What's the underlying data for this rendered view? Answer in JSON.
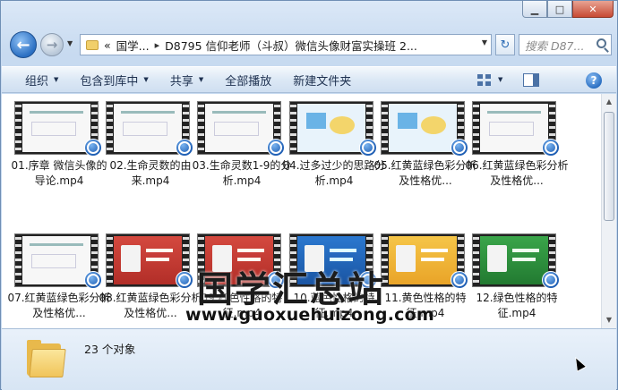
{
  "window": {
    "controls": {
      "minimize": "▁",
      "maximize": "□",
      "close": "✕"
    }
  },
  "nav": {
    "back_glyph": "←",
    "forward_glyph": "→"
  },
  "address": {
    "crumb_prefix": "«",
    "crumbs": [
      "国学...",
      "D8795 信仰老师（斗叔）微信头像财富实操班 2..."
    ],
    "separator": "▸"
  },
  "search": {
    "placeholder": "搜索 D87..."
  },
  "commands": [
    {
      "label": "组织",
      "has_dropdown": true
    },
    {
      "label": "包含到库中",
      "has_dropdown": true
    },
    {
      "label": "共享",
      "has_dropdown": true
    },
    {
      "label": "全部播放",
      "has_dropdown": false
    },
    {
      "label": "新建文件夹",
      "has_dropdown": false
    }
  ],
  "help_glyph": "?",
  "files": [
    {
      "name": "01.序章 微信头像的导论.mp4",
      "thumb": "white"
    },
    {
      "name": "02.生命灵数的由来.mp4",
      "thumb": "white"
    },
    {
      "name": "03.生命灵数1-9的分析.mp4",
      "thumb": "white"
    },
    {
      "name": "04.过多过少的思路分析.mp4",
      "thumb": "lightblue"
    },
    {
      "name": "05.红黄蓝绿色彩分析及性格优...",
      "thumb": "lightblue"
    },
    {
      "name": "06.红黄蓝绿色彩分析及性格优...",
      "thumb": "white"
    },
    {
      "name": "07.红黄蓝绿色彩分析及性格优...",
      "thumb": "white"
    },
    {
      "name": "08.红黄蓝绿色彩分析及性格优...",
      "thumb": "red"
    },
    {
      "name": "09.红色性格的特征.mp4",
      "thumb": "red"
    },
    {
      "name": "10.蓝色性格的特征.mp4",
      "thumb": "blue"
    },
    {
      "name": "11.黄色性格的特征.mp4",
      "thumb": "yellow"
    },
    {
      "name": "12.绿色性格的特征.mp4",
      "thumb": "green"
    }
  ],
  "watermark": {
    "title": "国学汇总站",
    "url": "www.guoxuehuizong.com"
  },
  "status": {
    "count_text": "23 个对象"
  }
}
